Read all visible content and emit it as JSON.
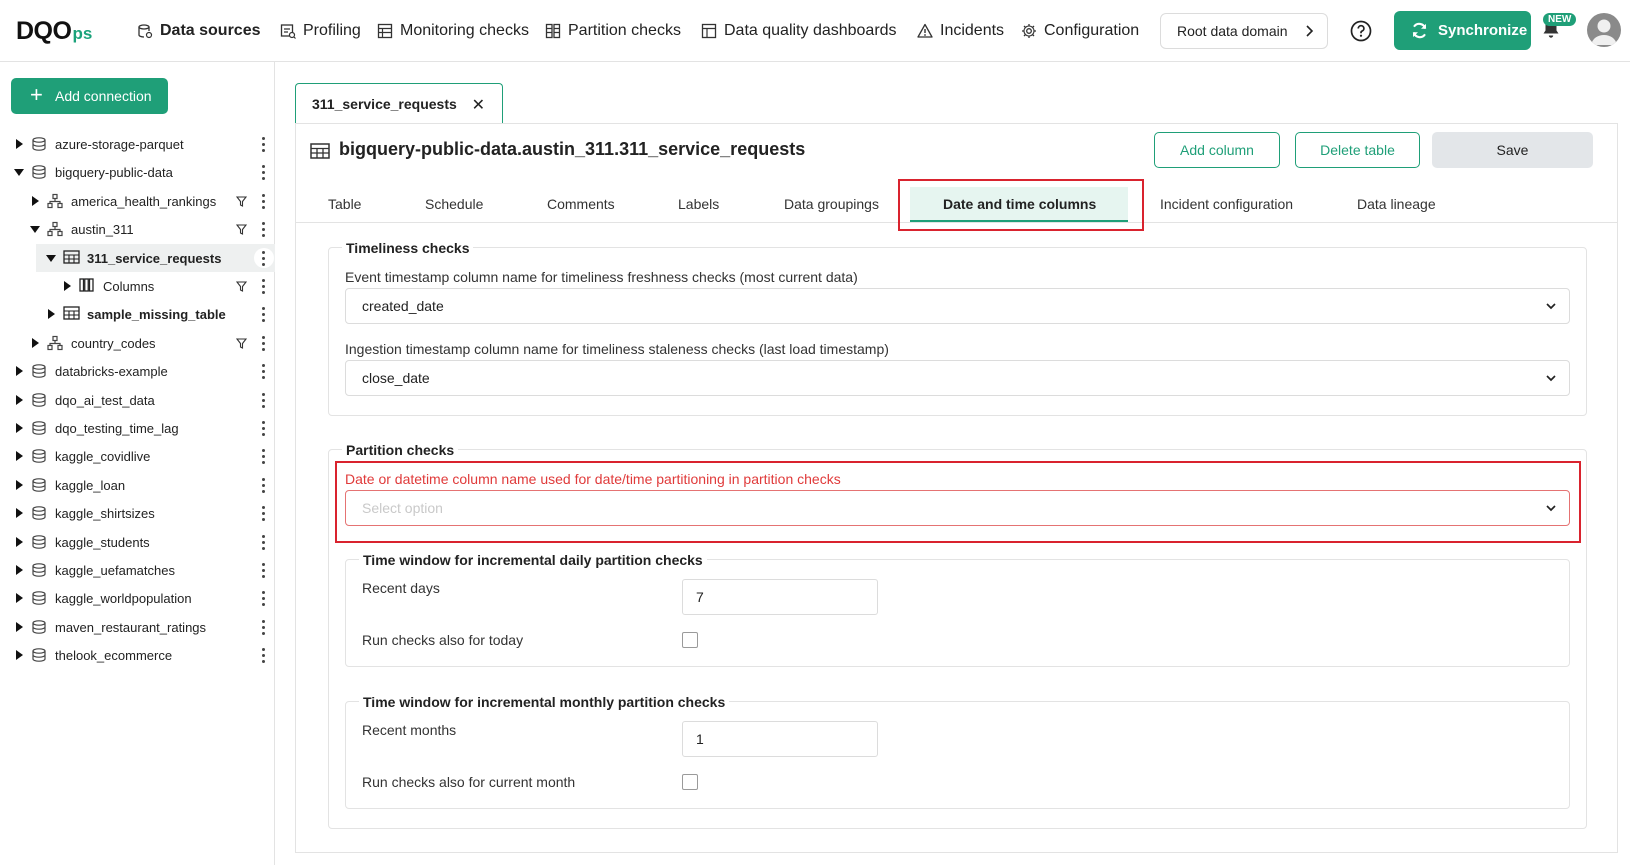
{
  "brand": {
    "main": "DQO",
    "sub": "ps"
  },
  "nav": {
    "items": [
      {
        "label": "Data sources",
        "icon": "database-sources-icon"
      },
      {
        "label": "Profiling",
        "icon": "profiling-icon"
      },
      {
        "label": "Monitoring checks",
        "icon": "monitoring-checks-icon"
      },
      {
        "label": "Partition checks",
        "icon": "partition-checks-icon"
      },
      {
        "label": "Data quality dashboards",
        "icon": "dashboard-icon"
      },
      {
        "label": "Incidents",
        "icon": "warning-triangle-icon"
      },
      {
        "label": "Configuration",
        "icon": "gear-icon"
      }
    ],
    "domain": "Root data domain",
    "sync_label": "Synchronize",
    "new_badge": "NEW"
  },
  "sidebar": {
    "add_connection": "Add connection",
    "tree": [
      {
        "label": "azure-storage-parquet",
        "type": "connection",
        "expanded": false
      },
      {
        "label": "bigquery-public-data",
        "type": "connection",
        "expanded": true
      },
      {
        "label": "america_health_rankings",
        "type": "schema",
        "expanded": false
      },
      {
        "label": "austin_311",
        "type": "schema",
        "expanded": true
      },
      {
        "label": "311_service_requests",
        "type": "table",
        "expanded": true,
        "selected": true
      },
      {
        "label": "Columns",
        "type": "columns",
        "expanded": false
      },
      {
        "label": "sample_missing_table",
        "type": "table",
        "expanded": false
      },
      {
        "label": "country_codes",
        "type": "schema",
        "expanded": false
      },
      {
        "label": "databricks-example",
        "type": "connection",
        "expanded": false
      },
      {
        "label": "dqo_ai_test_data",
        "type": "connection",
        "expanded": false
      },
      {
        "label": "dqo_testing_time_lag",
        "type": "connection",
        "expanded": false
      },
      {
        "label": "kaggle_covidlive",
        "type": "connection",
        "expanded": false
      },
      {
        "label": "kaggle_loan",
        "type": "connection",
        "expanded": false
      },
      {
        "label": "kaggle_shirtsizes",
        "type": "connection",
        "expanded": false
      },
      {
        "label": "kaggle_students",
        "type": "connection",
        "expanded": false
      },
      {
        "label": "kaggle_uefamatches",
        "type": "connection",
        "expanded": false
      },
      {
        "label": "kaggle_worldpopulation",
        "type": "connection",
        "expanded": false
      },
      {
        "label": "maven_restaurant_ratings",
        "type": "connection",
        "expanded": false
      },
      {
        "label": "thelook_ecommerce",
        "type": "connection",
        "expanded": false
      }
    ]
  },
  "main": {
    "open_tab": "311_service_requests",
    "title": "bigquery-public-data.austin_311.311_service_requests",
    "add_column": "Add column",
    "delete_table": "Delete table",
    "save": "Save",
    "tabs": [
      "Table",
      "Schedule",
      "Comments",
      "Labels",
      "Data groupings",
      "Date and time columns",
      "Incident configuration",
      "Data lineage"
    ],
    "active_tab": "Date and time columns",
    "timeliness": {
      "title": "Timeliness checks",
      "event_label": "Event timestamp column name for timeliness freshness checks (most current data)",
      "event_value": "created_date",
      "ingestion_label": "Ingestion timestamp column name for timeliness staleness checks (last load timestamp)",
      "ingestion_value": "close_date"
    },
    "partition": {
      "title": "Partition checks",
      "column_label": "Date or datetime column name used for date/time partitioning in partition checks",
      "column_placeholder": "Select option",
      "daily": {
        "title": "Time window for incremental daily partition checks",
        "recent_label": "Recent days",
        "recent_value": "7",
        "today_label": "Run checks also for today",
        "today_checked": false
      },
      "monthly": {
        "title": "Time window for incremental monthly partition checks",
        "recent_label": "Recent months",
        "recent_value": "1",
        "current_label": "Run checks also for current month",
        "current_checked": false
      }
    }
  },
  "colors": {
    "accent": "#1f9f78",
    "highlight": "#d9232e",
    "error_text": "#e03a3a"
  }
}
